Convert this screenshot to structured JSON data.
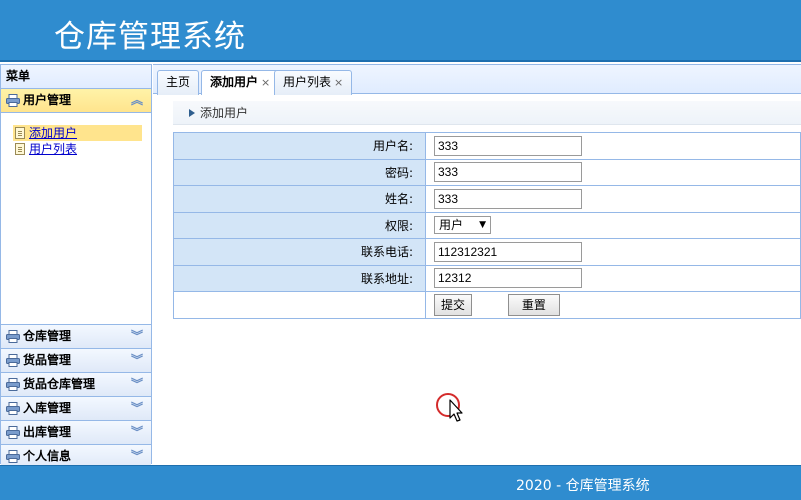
{
  "app": {
    "title": "仓库管理系统"
  },
  "sidebar": {
    "title": "菜单",
    "active_group": {
      "label": "用户管理",
      "items": [
        {
          "label": "添加用户",
          "selected": true
        },
        {
          "label": "用户列表",
          "selected": false
        }
      ]
    },
    "groups": [
      {
        "label": "仓库管理"
      },
      {
        "label": "货品管理"
      },
      {
        "label": "货品仓库管理"
      },
      {
        "label": "入库管理"
      },
      {
        "label": "出库管理"
      },
      {
        "label": "个人信息"
      }
    ]
  },
  "tabs": [
    {
      "label": "主页",
      "closable": false,
      "active": false
    },
    {
      "label": "添加用户",
      "closable": true,
      "active": true
    },
    {
      "label": "用户列表",
      "closable": true,
      "active": false
    }
  ],
  "panel": {
    "title": "添加用户"
  },
  "form": {
    "username_label": "用户名:",
    "username_value": "333",
    "password_label": "密码:",
    "password_value": "333",
    "name_label": "姓名:",
    "name_value": "333",
    "role_label": "权限:",
    "role_value": "用户",
    "phone_label": "联系电话:",
    "phone_value": "112312321",
    "address_label": "联系地址:",
    "address_value": "12312",
    "submit_label": "提交",
    "reset_label": "重置"
  },
  "footer": {
    "text": "2020 - 仓库管理系统"
  },
  "colors": {
    "header": "#2f8ccf",
    "border": "#95b8e7",
    "label_cell": "#d3e5f7",
    "active_group": "#ffe48d"
  }
}
